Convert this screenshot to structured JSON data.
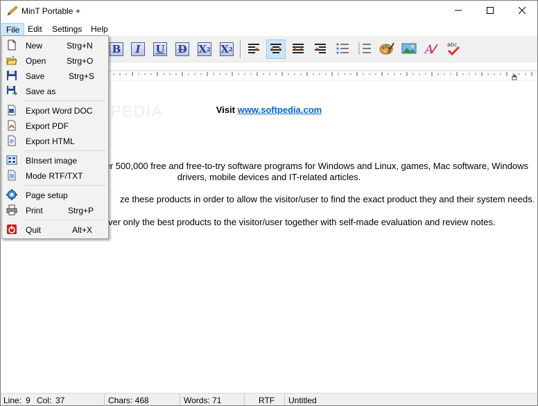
{
  "window": {
    "title": "MinT Portable +"
  },
  "menubar": {
    "file": "File",
    "edit": "Edit",
    "settings": "Settings",
    "help": "Help"
  },
  "toolbar": {
    "format_buttons": [
      "B",
      "I",
      "U",
      "D"
    ],
    "superscript": "X",
    "superscript_mark": "2",
    "subscript": "X",
    "subscript_mark": "2"
  },
  "file_menu": {
    "items": [
      {
        "label": "New",
        "shortcut": "Strg+N",
        "icon": "new-document-icon"
      },
      {
        "label": "Open",
        "shortcut": "Strg+O",
        "icon": "open-folder-icon"
      },
      {
        "label": "Save",
        "shortcut": "Strg+S",
        "icon": "save-disk-icon"
      },
      {
        "label": "Save as",
        "shortcut": "",
        "icon": "save-as-icon"
      },
      {
        "label": "Export Word DOC",
        "shortcut": "",
        "icon": "word-doc-icon"
      },
      {
        "label": "Export PDF",
        "shortcut": "",
        "icon": "pdf-icon"
      },
      {
        "label": "Export HTML",
        "shortcut": "",
        "icon": "html-icon"
      },
      {
        "label": "BInsert image",
        "shortcut": "",
        "icon": "insert-image-icon"
      },
      {
        "label": "Mode RTF/TXT",
        "shortcut": "",
        "icon": "mode-icon"
      },
      {
        "label": "Page setup",
        "shortcut": "",
        "icon": "page-setup-icon"
      },
      {
        "label": "Print",
        "shortcut": "Strg+P",
        "icon": "printer-icon"
      },
      {
        "label": "Quit",
        "shortcut": "Alt+X",
        "icon": "quit-icon"
      }
    ]
  },
  "document": {
    "visit_prefix": "Visit ",
    "visit_link": "www.softpedia.com",
    "watermark": "SOFTPEDIA",
    "line1": "ver 500,000 free and free-to-try software programs for Windows and Linux, games, Mac software, Windows",
    "line2": "drivers, mobile devices and IT-related articles.",
    "line3": "ze these products in order to allow the visitor/user to find the exact product they and their system needs.",
    "line4": "ver only the best products to the visitor/user together with self-made evaluation and review notes."
  },
  "statusbar": {
    "line_label": "Line:",
    "line_value": "9",
    "col_label": "Col:",
    "col_value": "37",
    "chars": "Chars: 468",
    "words": "Words: 71",
    "mode": "RTF",
    "filename": "Untitled"
  },
  "colors": {
    "menu_active": "#cce8ff",
    "link": "#0066cc",
    "toolbar_bg": "#f0f0f0"
  }
}
